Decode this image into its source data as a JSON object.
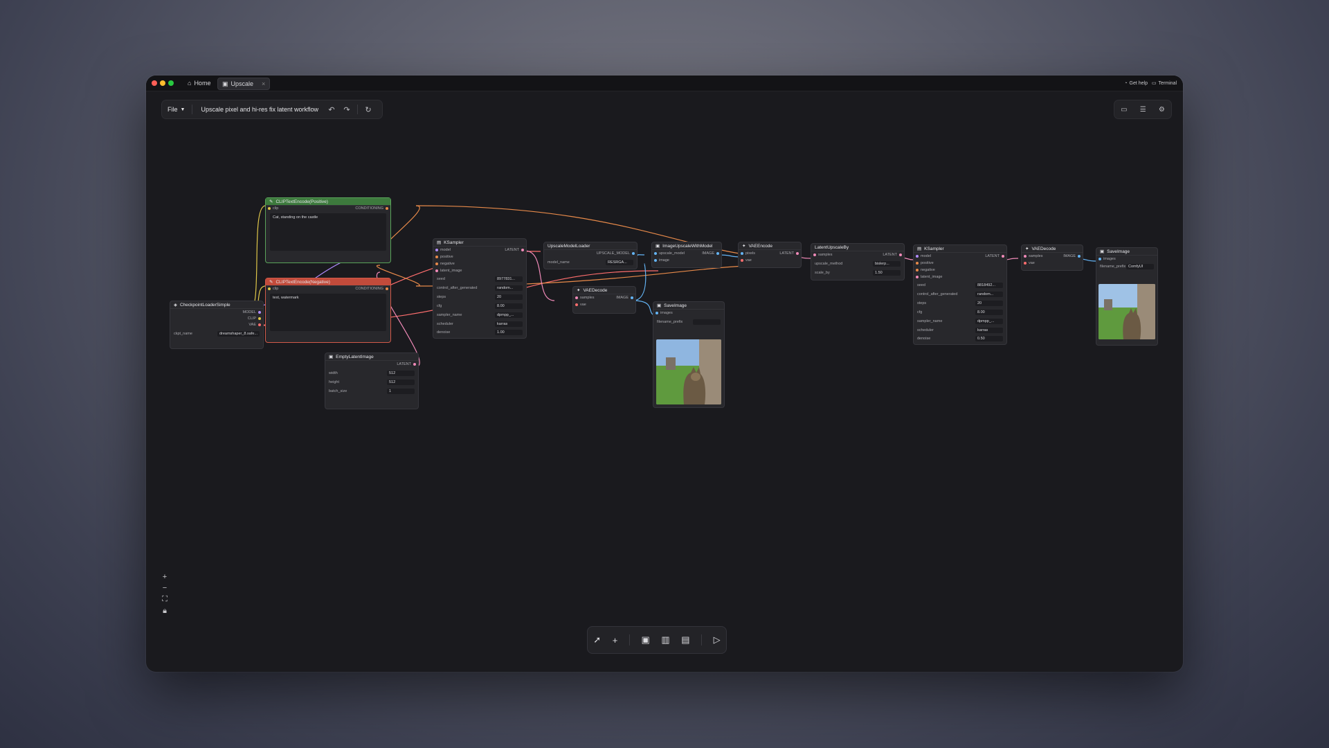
{
  "tabs": {
    "home": "Home",
    "upscale": "Upscale",
    "get_help": "Get help",
    "terminal": "Terminal"
  },
  "toolbar": {
    "file": "File",
    "workflow_title": "Upscale pixel and hi-res fix latent workflow"
  },
  "nodes": {
    "clip_pos": {
      "title": "CLIPTextEncode(Positive)",
      "in": "clip",
      "out": "CONDITIONING",
      "text": "Cat, standing on the castle"
    },
    "clip_neg": {
      "title": "CLIPTextEncode(Negative)",
      "in": "clip",
      "out": "CONDITIONING",
      "text": "text, watermark"
    },
    "checkpoint": {
      "title": "CheckpointLoaderSimple",
      "out_model": "MODEL",
      "out_clip": "CLIP",
      "out_vae": "VAE",
      "ckpt_label": "ckpt_name",
      "ckpt_value": "dreamshaper_8.safe..."
    },
    "empty_latent": {
      "title": "EmptyLatentImage",
      "out": "LATENT",
      "width_label": "width",
      "width": "512",
      "height_label": "height",
      "height": "512",
      "batch_label": "batch_size",
      "batch": "1"
    },
    "ksampler1": {
      "title": "KSampler",
      "in_model": "model",
      "in_pos": "positive",
      "in_neg": "negative",
      "in_latent": "latent_image",
      "out": "LATENT",
      "seed_label": "seed",
      "seed": "8977831...",
      "ctrl_label": "control_after_generated",
      "ctrl": "random...",
      "steps_label": "steps",
      "steps": "20",
      "cfg_label": "cfg",
      "cfg": "8.00",
      "sampler_label": "sampler_name",
      "sampler": "dpmpp_...",
      "scheduler_label": "scheduler",
      "scheduler": "karras",
      "denoise_label": "denoise",
      "denoise": "1.00"
    },
    "upscale_loader": {
      "title": "UpscaleModelLoader",
      "out": "UPSCALE_MODEL",
      "model_label": "model_name",
      "model": "RESRGA..."
    },
    "vae_decode1": {
      "title": "VAEDecode",
      "in_samples": "samples",
      "in_vae": "vae",
      "out": "IMAGE"
    },
    "image_upscale": {
      "title": "ImageUpscaleWithModel",
      "in_model": "upscale_model",
      "in_image": "image",
      "out": "IMAGE"
    },
    "save1": {
      "title": "SaveImage",
      "in": "images",
      "prefix_label": "filename_prefix"
    },
    "vae_encode": {
      "title": "VAEEncode",
      "in_pixels": "pixels",
      "in_vae": "vae",
      "out": "LATENT"
    },
    "latent_upscale": {
      "title": "LatentUpscaleBy",
      "in": "samples",
      "out": "LATENT",
      "method_label": "upscale_method",
      "method": "bislerp...",
      "scale_label": "scale_by",
      "scale": "1.50"
    },
    "ksampler2": {
      "title": "KSampler",
      "in_model": "model",
      "in_pos": "positive",
      "in_neg": "negative",
      "in_latent": "latent_image",
      "out": "LATENT",
      "seed_label": "seed",
      "seed": "8818492...",
      "ctrl_label": "control_after_generated",
      "ctrl": "random...",
      "steps_label": "steps",
      "steps": "20",
      "cfg_label": "cfg",
      "cfg": "8.00",
      "sampler_label": "sampler_name",
      "sampler": "dpmpp_...",
      "scheduler_label": "scheduler",
      "scheduler": "karras",
      "denoise_label": "denoise",
      "denoise": "0.50"
    },
    "vae_decode2": {
      "title": "VAEDecode",
      "in_samples": "samples",
      "in_vae": "vae",
      "out": "IMAGE"
    },
    "save2": {
      "title": "SaveImage",
      "in": "images",
      "prefix_label": "filename_prefix",
      "prefix": "ComfyUI"
    }
  },
  "colors": {
    "accent_arrow": "#17a08a",
    "wire_model": "#b18cff",
    "wire_clip": "#e0c84a",
    "wire_cond": "#e88a4a",
    "wire_latent": "#f08ab8",
    "wire_image": "#64b5f6",
    "wire_vae": "#ff6e6e"
  }
}
